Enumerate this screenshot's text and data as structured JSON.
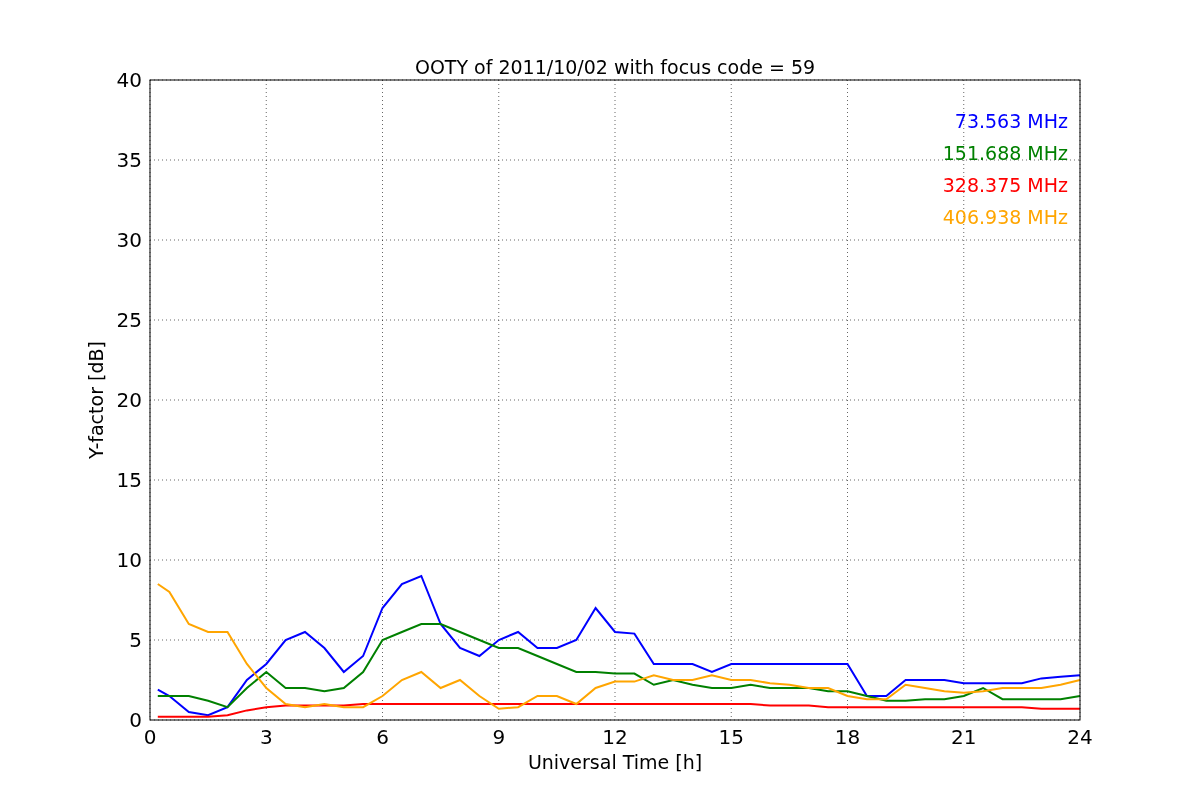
{
  "figure": {
    "chart_data": {
      "type": "line",
      "title": "OOTY of 2011/10/02 with focus code = 59",
      "xlabel": "Universal Time [h]",
      "ylabel": "Y-factor [dB]",
      "x": [
        0.2,
        0.5,
        1,
        1.5,
        2,
        2.5,
        3,
        3.5,
        4,
        4.5,
        5,
        5.5,
        6,
        6.5,
        7,
        7.5,
        8,
        8.5,
        9,
        9.5,
        10,
        10.5,
        11,
        11.5,
        12,
        12.5,
        13,
        13.5,
        14,
        14.5,
        15,
        15.5,
        16,
        16.5,
        17,
        17.5,
        18,
        18.5,
        19,
        19.5,
        20,
        20.5,
        21,
        21.5,
        22,
        22.5,
        23,
        23.5,
        24
      ],
      "series": [
        {
          "name": "73.563 MHz",
          "color": "#0000ff",
          "values": [
            1.9,
            1.5,
            0.5,
            0.3,
            0.8,
            2.5,
            3.5,
            5,
            5.5,
            4.5,
            3,
            4,
            7,
            8.5,
            9,
            6,
            4.5,
            4,
            5,
            5.5,
            4.5,
            4.5,
            5,
            7,
            5.5,
            5.4,
            3.5,
            3.5,
            3.5,
            3,
            3.5,
            3.5,
            3.5,
            3.5,
            3.5,
            3.5,
            3.5,
            1.5,
            1.5,
            2.5,
            2.5,
            2.5,
            2.3,
            2.3,
            2.3,
            2.3,
            2.6,
            2.7,
            2.8
          ]
        },
        {
          "name": "151.688 MHz",
          "color": "#008000",
          "values": [
            1.5,
            1.5,
            1.5,
            1.2,
            0.8,
            2,
            3,
            2,
            2,
            1.8,
            2,
            3,
            5,
            5.5,
            6,
            6,
            5.5,
            5,
            4.5,
            4.5,
            4,
            3.5,
            3,
            3,
            2.9,
            2.9,
            2.2,
            2.5,
            2.2,
            2,
            2,
            2.2,
            2,
            2,
            2,
            1.8,
            1.8,
            1.5,
            1.2,
            1.2,
            1.3,
            1.3,
            1.5,
            2,
            1.3,
            1.3,
            1.3,
            1.3,
            1.5
          ]
        },
        {
          "name": "328.375 MHz",
          "color": "#ff0000",
          "values": [
            0.2,
            0.2,
            0.2,
            0.2,
            0.3,
            0.6,
            0.8,
            0.9,
            0.9,
            0.9,
            0.9,
            1,
            1,
            1,
            1,
            1,
            1,
            1,
            1,
            1,
            1,
            1,
            1,
            1,
            1,
            1,
            1,
            1,
            1,
            1,
            1,
            1,
            0.9,
            0.9,
            0.9,
            0.8,
            0.8,
            0.8,
            0.8,
            0.8,
            0.8,
            0.8,
            0.8,
            0.8,
            0.8,
            0.8,
            0.7,
            0.7,
            0.7
          ]
        },
        {
          "name": "406.938 MHz",
          "color": "#ffa500",
          "values": [
            8.5,
            8,
            6,
            5.5,
            5.5,
            3.5,
            2,
            1,
            0.8,
            1,
            0.8,
            0.8,
            1.5,
            2.5,
            3,
            2,
            2.5,
            1.5,
            0.7,
            0.8,
            1.5,
            1.5,
            1,
            2,
            2.4,
            2.4,
            2.8,
            2.5,
            2.5,
            2.8,
            2.5,
            2.5,
            2.3,
            2.2,
            2,
            2,
            1.5,
            1.3,
            1.3,
            2.2,
            2,
            1.8,
            1.7,
            1.8,
            2,
            2,
            2,
            2.2,
            2.5
          ]
        }
      ],
      "grid": true,
      "xlim": [
        0,
        24
      ],
      "ylim": [
        0,
        40
      ],
      "xticks": [
        0,
        3,
        6,
        9,
        12,
        15,
        18,
        21,
        24
      ],
      "yticks": [
        0,
        5,
        10,
        15,
        20,
        25,
        30,
        35,
        40
      ]
    }
  }
}
